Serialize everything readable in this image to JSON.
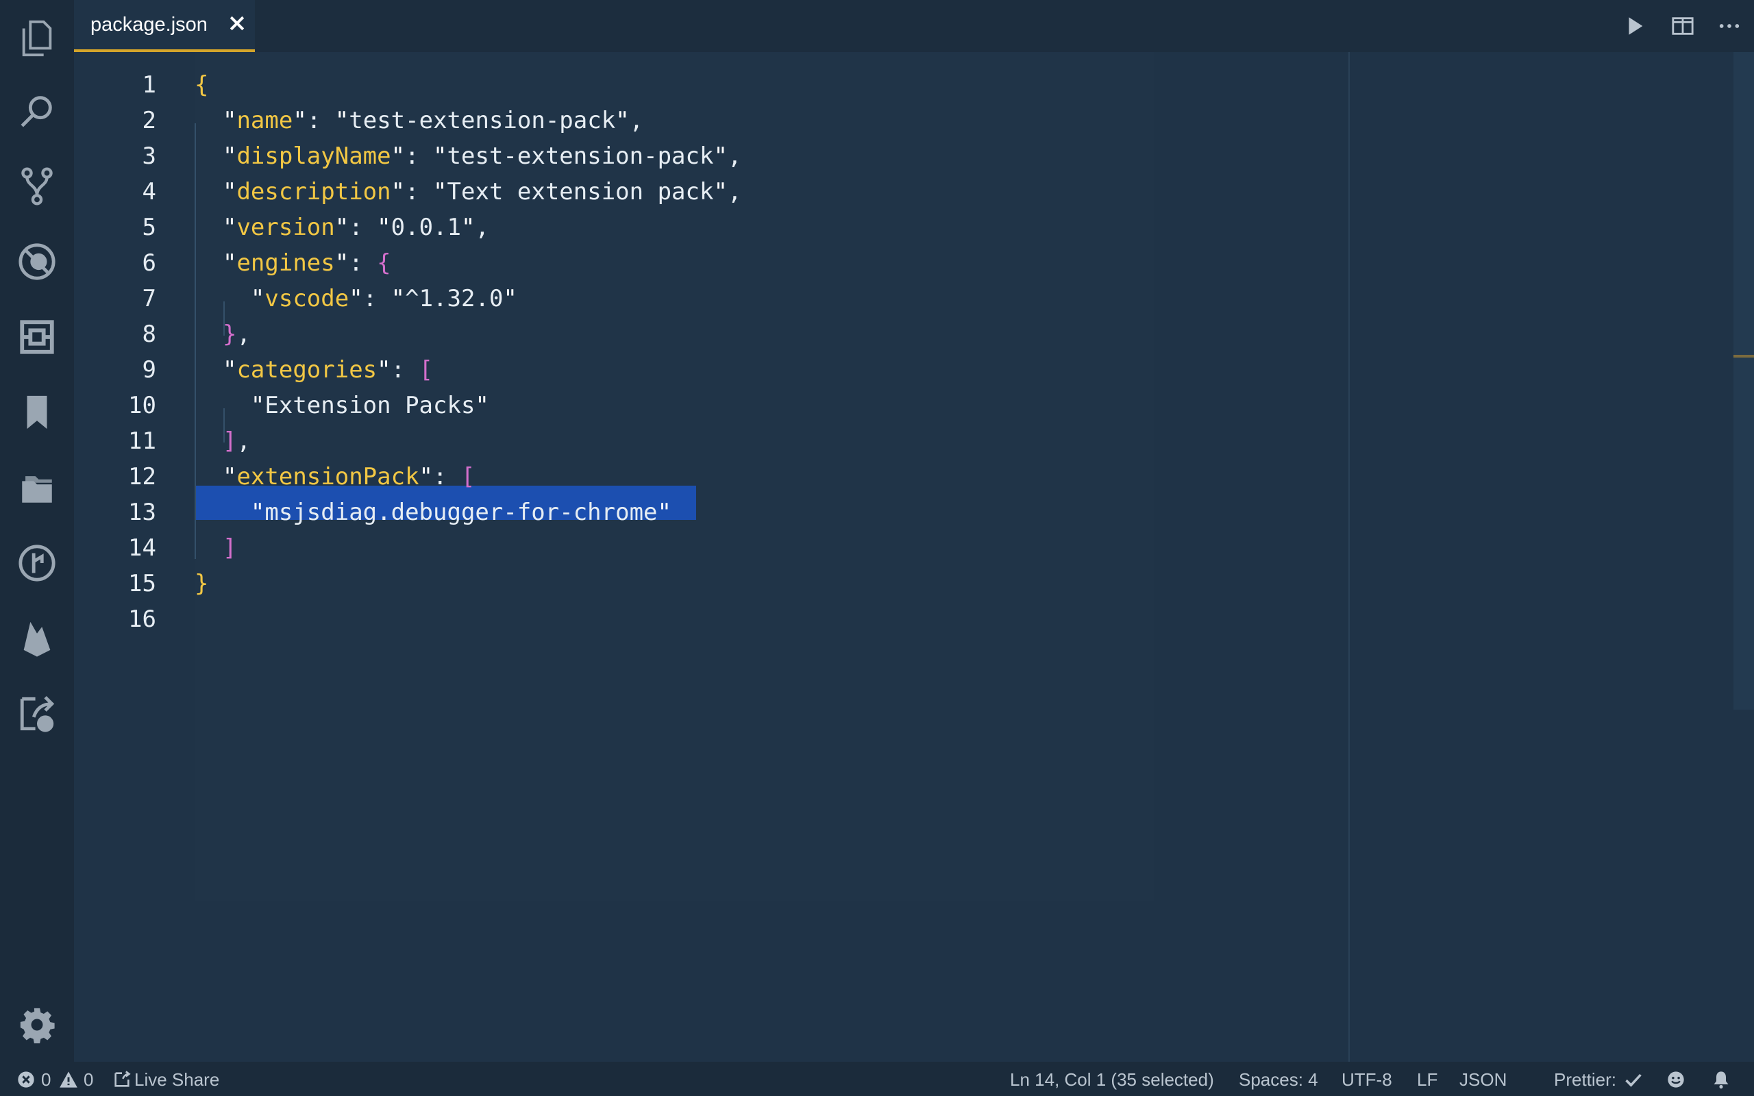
{
  "tab": {
    "label": "package.json"
  },
  "editor": {
    "lines": [
      {
        "n": "1"
      },
      {
        "n": "2"
      },
      {
        "n": "3"
      },
      {
        "n": "4"
      },
      {
        "n": "5"
      },
      {
        "n": "6"
      },
      {
        "n": "7"
      },
      {
        "n": "8"
      },
      {
        "n": "9"
      },
      {
        "n": "10"
      },
      {
        "n": "11"
      },
      {
        "n": "12"
      },
      {
        "n": "13"
      },
      {
        "n": "14"
      },
      {
        "n": "15"
      },
      {
        "n": "16"
      }
    ],
    "tokens": {
      "name_key": "name",
      "name_val": "test-extension-pack",
      "displayName_key": "displayName",
      "displayName_val": "test-extension-pack",
      "description_key": "description",
      "description_val": "Text extension pack",
      "version_key": "version",
      "version_val": "0.0.1",
      "engines_key": "engines",
      "vscode_key": "vscode",
      "vscode_val": "^1.32.0",
      "categories_key": "categories",
      "category_0": "Extension Packs",
      "extensionPack_key": "extensionPack",
      "extension_0": "msjsdiag.debugger-for-chrome"
    }
  },
  "status": {
    "errors": "0",
    "warnings": "0",
    "live_share": "Live Share",
    "position": "Ln 14, Col 1 (35 selected)",
    "spaces": "Spaces: 4",
    "encoding": "UTF-8",
    "eol": "LF",
    "language": "JSON",
    "prettier": "Prettier:"
  },
  "colors": {
    "accent": "#d4a52a",
    "selection": "#1c4fb0",
    "background": "#1f3347",
    "key": "#f2c744",
    "bracket_purple": "#d36fcc"
  }
}
